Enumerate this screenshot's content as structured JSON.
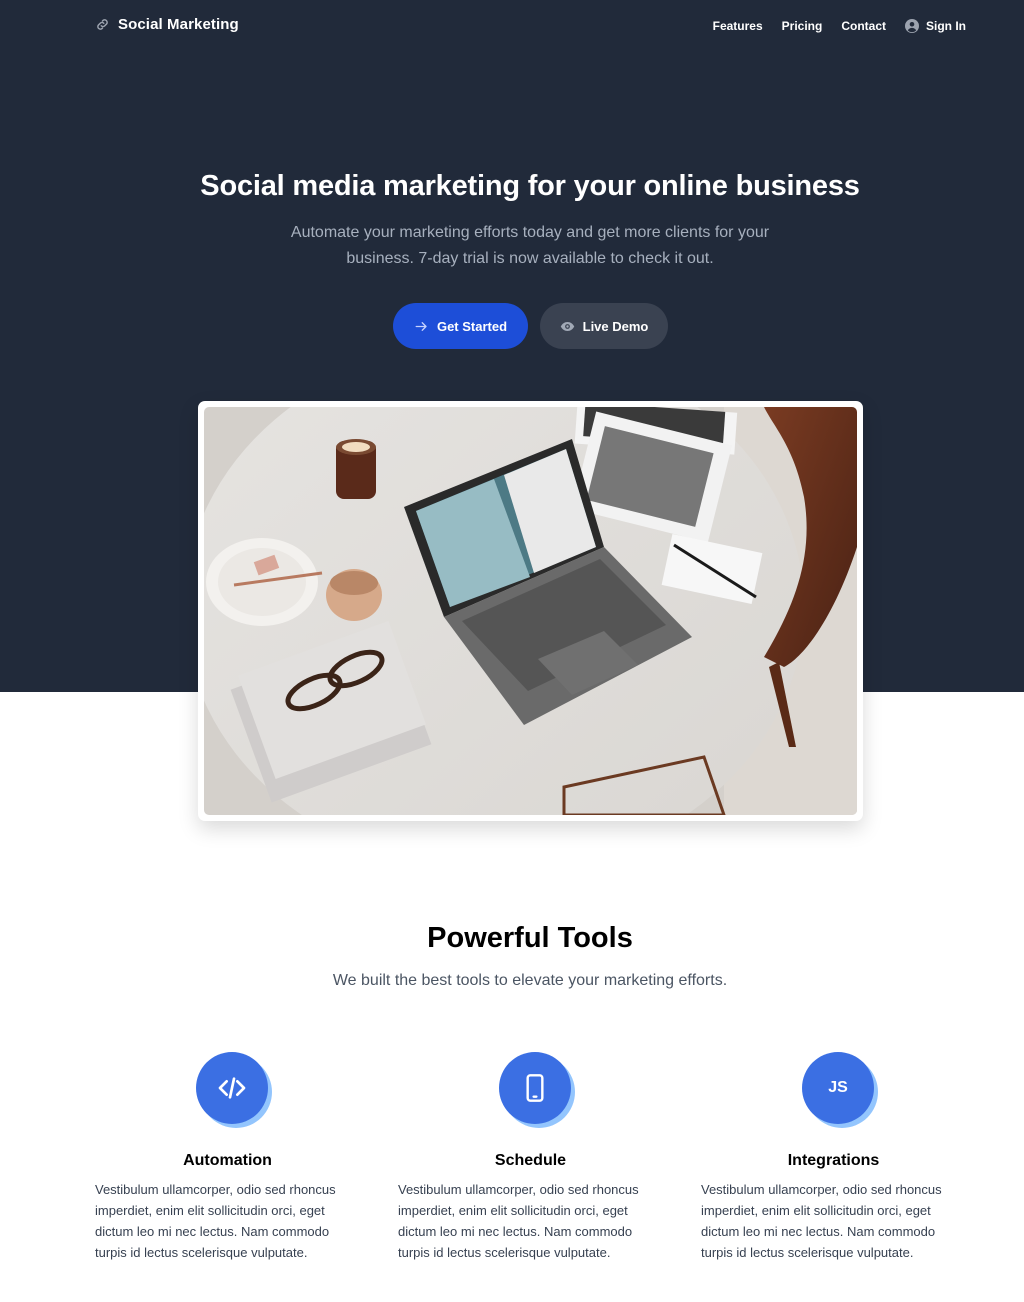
{
  "nav": {
    "brand": "Social Marketing",
    "brand_icon": "link-icon",
    "links": [
      "Features",
      "Pricing",
      "Contact"
    ],
    "signin_label": "Sign In",
    "signin_icon": "user-circle-icon"
  },
  "hero": {
    "title": "Social media marketing for your online business",
    "subtitle": "Automate your marketing efforts today and get more clients for your business. 7-day trial is now available to check it out.",
    "primary_button": "Get Started",
    "primary_icon": "arrow-right-icon",
    "secondary_button": "Live Demo",
    "secondary_icon": "eye-icon"
  },
  "tools": {
    "title": "Powerful Tools",
    "subtitle": "We built the best tools to elevate your marketing efforts.",
    "features": [
      {
        "title": "Automation",
        "icon": "code-icon",
        "text": "Vestibulum ullamcorper, odio sed rhoncus imperdiet, enim elit sollicitudin orci, eget dictum leo mi nec lectus. Nam commodo turpis id lectus scelerisque vulputate."
      },
      {
        "title": "Schedule",
        "icon": "mobile-phone-icon",
        "text": "Vestibulum ullamcorper, odio sed rhoncus imperdiet, enim elit sollicitudin orci, eget dictum leo mi nec lectus. Nam commodo turpis id lectus scelerisque vulputate."
      },
      {
        "title": "Integrations",
        "icon_text": "JS",
        "icon": "javascript-icon",
        "text": "Vestibulum ullamcorper, odio sed rhoncus imperdiet, enim elit sollicitudin orci, eget dictum leo mi nec lectus. Nam commodo turpis id lectus scelerisque vulputate."
      }
    ]
  },
  "colors": {
    "hero_background": "#212a3a",
    "primary": "#1d4ed8",
    "secondary_button": "#3a4251",
    "feature_icon": "#3b6fe3"
  }
}
